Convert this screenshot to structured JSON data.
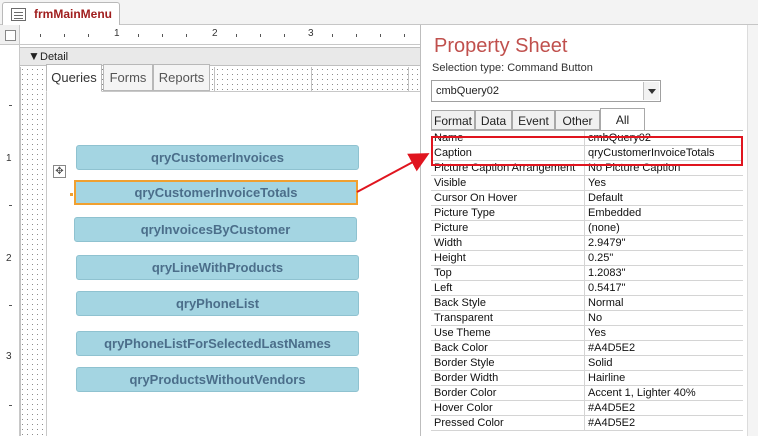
{
  "document_tab": {
    "title": "frmMainMenu",
    "icon": "form-icon"
  },
  "ruler": {
    "numbers": [
      "1",
      "2",
      "3"
    ],
    "vnumbers": [
      "1",
      "2",
      "3"
    ]
  },
  "section": {
    "label": "Detail"
  },
  "tabs": [
    {
      "label": "Queries",
      "active": true
    },
    {
      "label": "Forms",
      "active": false
    },
    {
      "label": "Reports",
      "active": false
    }
  ],
  "buttons": [
    {
      "label": "qryCustomerInvoices"
    },
    {
      "label": "qryCustomerInvoiceTotals",
      "selected": true
    },
    {
      "label": "qryInvoicesByCustomer"
    },
    {
      "label": "qryLineWithProducts"
    },
    {
      "label": "qryPhoneList"
    },
    {
      "label": "qryPhoneListForSelectedLastNames"
    },
    {
      "label": "qryProductsWithoutVendors"
    }
  ],
  "property_sheet": {
    "title": "Property Sheet",
    "selection_type_label": "Selection type:",
    "selection_type_value": "Command Button",
    "combo_value": "cmbQuery02",
    "tabs": [
      "Format",
      "Data",
      "Event",
      "Other",
      "All"
    ],
    "active_tab": "All",
    "properties": [
      {
        "name": "Name",
        "value": "cmbQuery02"
      },
      {
        "name": "Caption",
        "value": "qryCustomerInvoiceTotals"
      },
      {
        "name": "Picture Caption Arrangement",
        "value": "No Picture Caption"
      },
      {
        "name": "Visible",
        "value": "Yes"
      },
      {
        "name": "Cursor On Hover",
        "value": "Default"
      },
      {
        "name": "Picture Type",
        "value": "Embedded"
      },
      {
        "name": "Picture",
        "value": "(none)"
      },
      {
        "name": "Width",
        "value": "2.9479\""
      },
      {
        "name": "Height",
        "value": "0.25\""
      },
      {
        "name": "Top",
        "value": "1.2083\""
      },
      {
        "name": "Left",
        "value": "0.5417\""
      },
      {
        "name": "Back Style",
        "value": "Normal"
      },
      {
        "name": "Transparent",
        "value": "No"
      },
      {
        "name": "Use Theme",
        "value": "Yes"
      },
      {
        "name": "Back Color",
        "value": "#A4D5E2"
      },
      {
        "name": "Border Style",
        "value": "Solid"
      },
      {
        "name": "Border Width",
        "value": "Hairline"
      },
      {
        "name": "Border Color",
        "value": "Accent 1, Lighter 40%"
      },
      {
        "name": "Hover Color",
        "value": "#A4D5E2"
      },
      {
        "name": "Pressed Color",
        "value": "#A4D5E2"
      }
    ]
  },
  "colors": {
    "button_back": "#A4D5E2",
    "annotation_red": "#e0151f",
    "selection_orange": "#f0a030"
  }
}
